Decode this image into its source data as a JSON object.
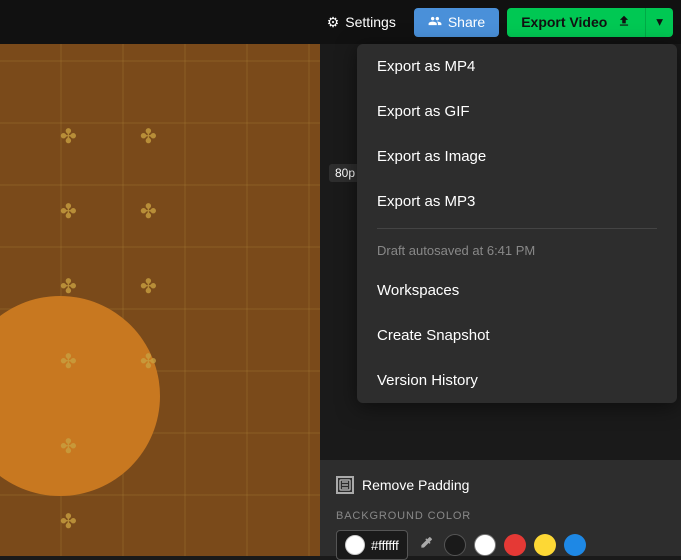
{
  "topbar": {
    "settings_label": "Settings",
    "share_label": "Share",
    "export_video_label": "Export Video"
  },
  "dropdown": {
    "items": [
      {
        "id": "export-mp4",
        "label": "Export as MP4"
      },
      {
        "id": "export-gif",
        "label": "Export as GIF"
      },
      {
        "id": "export-image",
        "label": "Export as Image"
      },
      {
        "id": "export-mp3",
        "label": "Export as MP3"
      }
    ],
    "autosave_text": "Draft autosaved at 6:41 PM",
    "workspace_label": "Workspaces",
    "create_snapshot_label": "Create Snapshot",
    "version_history_label": "Version History"
  },
  "panel": {
    "remove_padding_label": "Remove Padding",
    "bg_color_label": "BACKGROUND COLOR",
    "color_hex": "#ffffff",
    "resolution_badge": "80p"
  },
  "colors": [
    {
      "id": "black",
      "hex": "#1a1a1a"
    },
    {
      "id": "white",
      "hex": "#ffffff"
    },
    {
      "id": "red",
      "hex": "#e53935"
    },
    {
      "id": "yellow",
      "hex": "#fdd835"
    },
    {
      "id": "blue",
      "hex": "#1e88e5"
    }
  ]
}
